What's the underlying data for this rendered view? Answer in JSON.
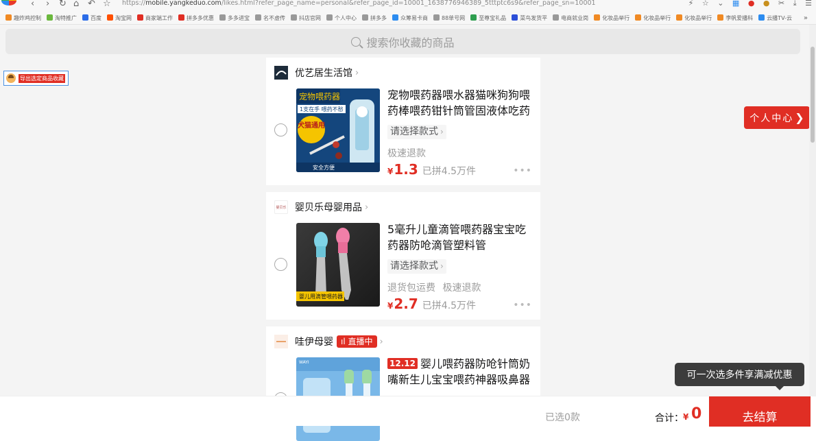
{
  "browser": {
    "url_prefix": "https://",
    "url_host": "mobile.yangkeduo.com",
    "url_path": "/likes.html?refer_page_name=personal&refer_page_id=10001_1638776946389_5tttptc6s9&refer_page_sn=10001",
    "bookmarks": [
      {
        "label": "趣炸鸡控制",
        "color": "#f08a24"
      },
      {
        "label": "淘特推广",
        "color": "#6bb83e"
      },
      {
        "label": "百度",
        "color": "#2c6de8"
      },
      {
        "label": "淘宝网",
        "color": "#ff5000"
      },
      {
        "label": "商家端工作",
        "color": "#e02e24"
      },
      {
        "label": "拼多多优惠",
        "color": "#e02e24"
      },
      {
        "label": "多多进宝",
        "color": "#999999"
      },
      {
        "label": "名不虚传",
        "color": "#999999"
      },
      {
        "label": "抖店官网",
        "color": "#999999"
      },
      {
        "label": "个人中心",
        "color": "#999999"
      },
      {
        "label": "拼多多",
        "color": "#999999"
      },
      {
        "label": "众筹易卡商",
        "color": "#2c8cf0"
      },
      {
        "label": "88单号网",
        "color": "#999999"
      },
      {
        "label": "至尊宝礼品",
        "color": "#2e9e4f"
      },
      {
        "label": "菜鸟发货平",
        "color": "#2c4fd8"
      },
      {
        "label": "电商就业岗",
        "color": "#999999"
      },
      {
        "label": "化妆品举行",
        "color": "#f08a24"
      },
      {
        "label": "化妆品举行",
        "color": "#f08a24"
      },
      {
        "label": "化妆品举行",
        "color": "#f08a24"
      },
      {
        "label": "李帆爱播科",
        "color": "#f08a24"
      },
      {
        "label": "云播TV-云",
        "color": "#2c8cf0"
      }
    ],
    "bookmark_more": "»"
  },
  "search": {
    "placeholder": "搜索你收藏的商品"
  },
  "export_tool": {
    "label": "导出选定商品收藏"
  },
  "personal_center": {
    "label": "个人中心",
    "chevron": "❯"
  },
  "items": [
    {
      "shop": "优艺居生活馆",
      "title": "宠物喂药器喂水器猫咪狗狗喂药棒喂药钳针筒管固液体吃药",
      "spec": "请选择款式",
      "tags": [
        "极速退款"
      ],
      "price_symbol": "¥",
      "price": "1.3",
      "sold": "已拼4.5万件",
      "image_caption_top": "宠物喂药器",
      "image_caption_mid": "1支在手 喂药不愁",
      "image_badge": "犬猫通用",
      "image_caption_bottom": "安全方便"
    },
    {
      "shop": "婴贝乐母婴用品",
      "shop_logo_text": "婴贝乐",
      "title": "5毫升儿童滴管喂药器宝宝吃药器防呛滴管塑料管",
      "spec": "请选择款式",
      "tags": [
        "退货包运费",
        "极速退款"
      ],
      "price_symbol": "¥",
      "price": "2.7",
      "sold": "已拼4.5万件",
      "image_caption": "婴儿用滴管喂药器"
    },
    {
      "shop": "哇伊母婴",
      "live_label": "直播中",
      "promo": "12.12",
      "title": "婴儿喂药器防呛针筒奶嘴新生儿宝宝喂药神器吸鼻器",
      "image_brand": "WAYI"
    }
  ],
  "tooltip": "可一次选多件享满减优惠",
  "bottom": {
    "selected": "已选0款",
    "total_label": "合计：",
    "total_symbol": "¥",
    "total_value": "0",
    "checkout": "去结算"
  }
}
